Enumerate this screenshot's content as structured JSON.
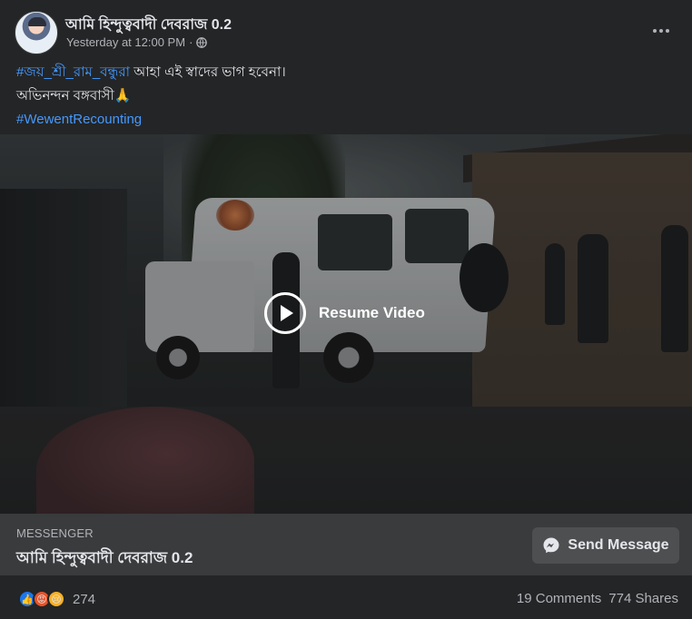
{
  "post": {
    "author": "আমি হিন্দুত্ববাদী দেবরাজ 0.2",
    "timestamp": "Yesterday at 12:00 PM",
    "separator": "·",
    "privacy_icon": "globe-icon",
    "hashtag_1": "#জয়_শ্রী_রাম_বন্ধুরা",
    "text_line_1": " আহা এই স্বাদের ভাগ হবেনা।",
    "text_line_2": "অভিনন্দন বঙ্গবাসী🙏",
    "hashtag_2": "#WewentRecounting"
  },
  "video": {
    "resume_label": "Resume Video",
    "play_icon": "play-icon"
  },
  "messenger": {
    "label": "MESSENGER",
    "name": "আমি হিন্দুত্ববাদী দেবরাজ 0.2",
    "button_label": "Send Message",
    "button_icon": "messenger-icon"
  },
  "footer": {
    "reaction_icons": [
      "like-icon",
      "angry-icon",
      "sad-icon"
    ],
    "reaction_count": "274",
    "comments": "19 Comments",
    "shares": "774 Shares"
  },
  "colors": {
    "background": "#242526",
    "hashtag": "#4599ff",
    "messenger_bar": "#3a3b3c",
    "like": "#1877f2",
    "angry": "#e7542a",
    "sad": "#f7b125"
  }
}
